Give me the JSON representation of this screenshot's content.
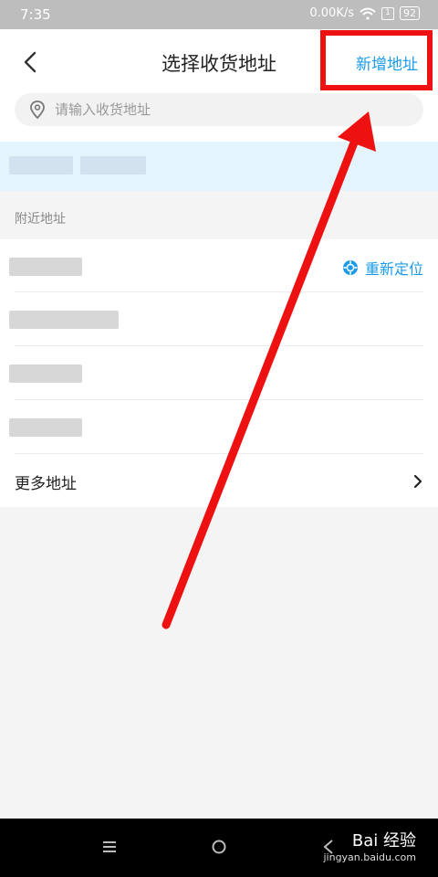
{
  "status_bar": {
    "time": "7:35",
    "net_speed": "0.00K/s",
    "sim": "1",
    "battery": "92"
  },
  "header": {
    "title": "选择收货地址",
    "add_label": "新增地址"
  },
  "search": {
    "placeholder": "请输入收货地址"
  },
  "nearby": {
    "section_label": "附近地址",
    "relocate_label": "重新定位",
    "more_label": "更多地址"
  },
  "watermark": {
    "brand": "Bai 经验",
    "url": "jingyan.baidu.com"
  },
  "colors": {
    "accent": "#1a9be8",
    "annotation": "#ee1111"
  }
}
